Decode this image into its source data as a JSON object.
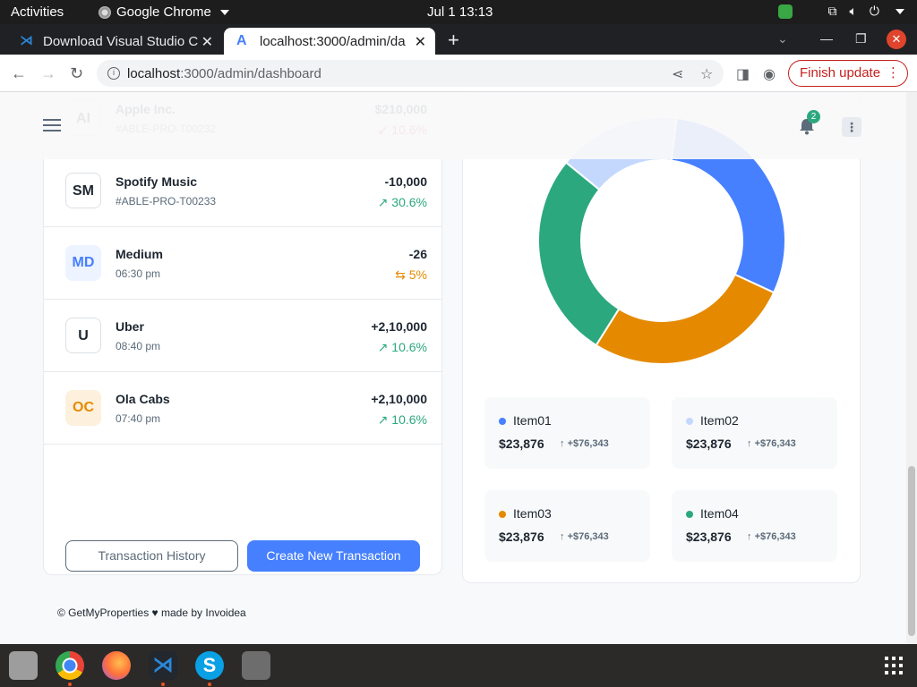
{
  "system_bar": {
    "activities": "Activities",
    "app_name": "Google Chrome",
    "clock": "Jul 1  13:13"
  },
  "browser": {
    "tabs": [
      {
        "title": "Download Visual Studio C"
      },
      {
        "title": "localhost:3000/admin/da"
      }
    ],
    "url_host": "localhost",
    "url_rest": ":3000/admin/dashboard",
    "finish_update": "Finish update"
  },
  "header": {
    "notification_count": "2"
  },
  "transactions": [
    {
      "initials": "AI",
      "name": "Apple Inc.",
      "sub": "#ABLE-PRO-T00232",
      "amount": "$210,000",
      "change": "↙ 10.6%",
      "trend": "down",
      "avatar_style": "plain"
    },
    {
      "initials": "SM",
      "name": "Spotify Music",
      "sub": "#ABLE-PRO-T00233",
      "amount": "-10,000",
      "change": "↗ 30.6%",
      "trend": "up",
      "avatar_style": "plain"
    },
    {
      "initials": "MD",
      "name": "Medium",
      "sub": "06:30 pm",
      "amount": "-26",
      "change": "⇆ 5%",
      "trend": "flat",
      "avatar_style": "blue"
    },
    {
      "initials": "U",
      "name": "Uber",
      "sub": "08:40 pm",
      "amount": "+2,10,000",
      "change": "↗ 10.6%",
      "trend": "up",
      "avatar_style": "plain"
    },
    {
      "initials": "OC",
      "name": "Ola Cabs",
      "sub": "07:40 pm",
      "amount": "+2,10,000",
      "change": "↗ 10.6%",
      "trend": "up",
      "avatar_style": "orange"
    }
  ],
  "actions": {
    "history": "Transaction History",
    "create": "Create New Transaction"
  },
  "legend": [
    {
      "name": "Item01",
      "value": "$23,876",
      "delta": "+$76,343",
      "color": "#4680ff"
    },
    {
      "name": "Item02",
      "value": "$23,876",
      "delta": "+$76,343",
      "color": "#c4d8fd"
    },
    {
      "name": "Item03",
      "value": "$23,876",
      "delta": "+$76,343",
      "color": "#e58a00"
    },
    {
      "name": "Item04",
      "value": "$23,876",
      "delta": "+$76,343",
      "color": "#2ca87f"
    }
  ],
  "chart_data": {
    "type": "pie",
    "categories": [
      "Item01",
      "Item03",
      "Item04",
      "Item02"
    ],
    "values": [
      30,
      27,
      27,
      16
    ],
    "colors": [
      "#4680ff",
      "#e58a00",
      "#2ca87f",
      "#c4d8fd"
    ]
  },
  "footer": {
    "text": "© GetMyProperties ♥ made by Invoidea"
  }
}
